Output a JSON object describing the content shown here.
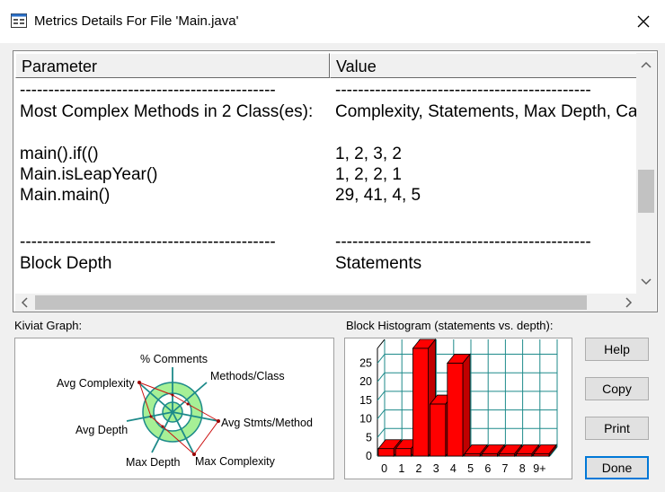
{
  "window": {
    "title": "Metrics Details For File 'Main.java'",
    "app_icon": "window-icon",
    "close_icon": "close-icon"
  },
  "table": {
    "headers": {
      "parameter": "Parameter",
      "value": "Value"
    },
    "rows": [
      {
        "param": "---------------------------------------------",
        "value": "---------------------------------------------"
      },
      {
        "param": "Most Complex Methods in 2 Class(es):",
        "value": "Complexity, Statements, Max Depth, Calls"
      },
      {
        "param": "",
        "value": ""
      },
      {
        "param": "main().if(()",
        "value": "1, 2, 3, 2"
      },
      {
        "param": "Main.isLeapYear()",
        "value": "1, 2, 2, 1"
      },
      {
        "param": "Main.main()",
        "value": "29, 41, 4, 5"
      },
      {
        "param": "",
        "value": ""
      },
      {
        "param": "---------------------------------------------",
        "value": "---------------------------------------------"
      },
      {
        "param": "Block Depth",
        "value": "Statements"
      }
    ]
  },
  "kiviat": {
    "label": "Kiviat Graph:",
    "axes": [
      "% Comments",
      "Methods/Class",
      "Avg Stmts/Method",
      "Max Complexity",
      "Max Depth",
      "Avg Depth",
      "Avg Complexity"
    ]
  },
  "histogram": {
    "label": "Block Histogram (statements vs. depth):",
    "y_ticks": [
      "25",
      "20",
      "15",
      "10",
      "5",
      "0"
    ],
    "x_ticks": [
      "0",
      "1",
      "2",
      "3",
      "4",
      "5",
      "6",
      "7",
      "8",
      "9+"
    ]
  },
  "chart_data": {
    "type": "bar",
    "categories": [
      "0",
      "1",
      "2",
      "3",
      "4",
      "5",
      "6",
      "7",
      "8",
      "9+"
    ],
    "values": [
      2,
      2,
      29,
      14,
      25,
      0,
      0,
      0,
      0,
      0
    ],
    "ylim": [
      0,
      29
    ],
    "color": "#ff0000"
  },
  "buttons": {
    "help": "Help",
    "copy": "Copy",
    "print": "Print",
    "done": "Done"
  }
}
